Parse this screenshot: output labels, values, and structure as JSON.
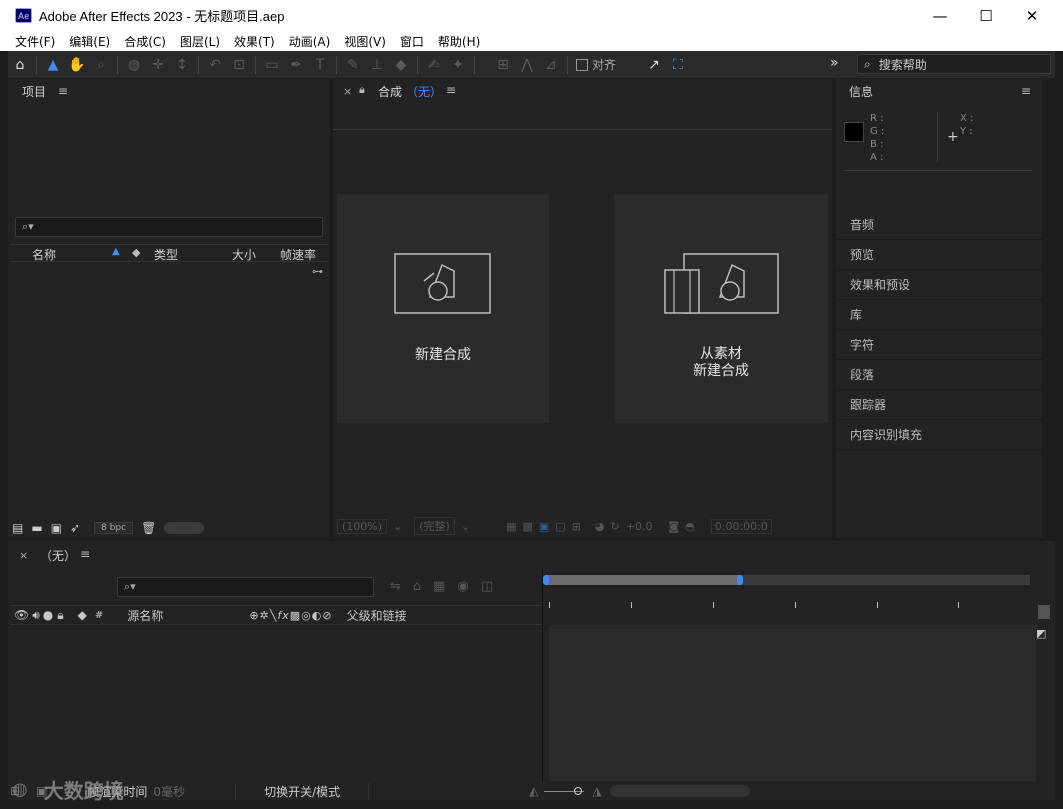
{
  "window": {
    "title": "Adobe After Effects 2023 - 无标题项目.aep",
    "icon_text": "Ae",
    "minimize": "—",
    "maximize": "☐",
    "close": "✕"
  },
  "menu": [
    "文件(F)",
    "编辑(E)",
    "合成(C)",
    "图层(L)",
    "效果(T)",
    "动画(A)",
    "视图(V)",
    "窗口",
    "帮助(H)"
  ],
  "toolbar": {
    "snap_label": "对齐",
    "search_help_placeholder": "搜索帮助",
    "expand": "»"
  },
  "project_panel": {
    "title": "项目",
    "menu_icon": "≡",
    "search_placeholder": "",
    "columns": {
      "name": "名称",
      "type": "类型",
      "size": "大小",
      "framerate": "帧速率"
    },
    "bpc": "8 bpc"
  },
  "comp_panel": {
    "tab_close": "×",
    "tab_label": "合成",
    "tab_value": "（无）",
    "new_comp": "新建合成",
    "from_footage_line1": "从素材",
    "from_footage_line2": "新建合成",
    "zoom": "(100%)",
    "resolution": "(完整)",
    "exposure": "+0.0",
    "timecode": "0:00:00:0"
  },
  "info_panel": {
    "title": "信息",
    "r": "R :",
    "g": "G :",
    "b": "B :",
    "a": "A :",
    "x": "X :",
    "y": "Y :"
  },
  "right_panels": [
    "音频",
    "预览",
    "效果和预设",
    "库",
    "字符",
    "段落",
    "跟踪器",
    "内容识别填充"
  ],
  "timeline": {
    "tab_close": "×",
    "tab_label": "（无）",
    "columns": {
      "hash": "#",
      "source_name": "源名称",
      "parent": "父级和链接"
    },
    "render_time_label": "帧渲染时间",
    "render_time_value": "0毫秒",
    "toggle_label": "切换开关/模式"
  },
  "watermark": "大数跨境",
  "colors": {
    "accent": "#3d8ef0",
    "panel": "#232323",
    "bg": "#1d1d1d"
  }
}
